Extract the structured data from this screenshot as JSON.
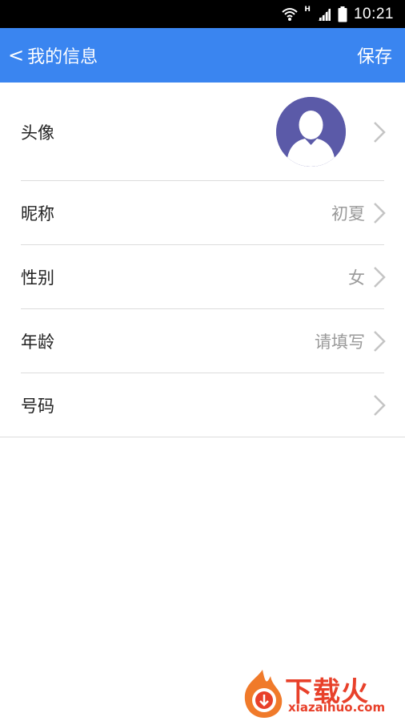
{
  "status_bar": {
    "network_type": "H",
    "time": "10:21",
    "icons": [
      "wifi-icon",
      "signal-icon",
      "battery-icon"
    ]
  },
  "header": {
    "back_label": "我的信息",
    "back_icon": "chevron-left-icon",
    "save_label": "保存",
    "background_color": "#3a85f0"
  },
  "rows": [
    {
      "label": "头像",
      "value": "",
      "icon": "avatar-placeholder"
    },
    {
      "label": "昵称",
      "value": "初夏"
    },
    {
      "label": "性别",
      "value": "女"
    },
    {
      "label": "年龄",
      "value": "请填写"
    },
    {
      "label": "号码",
      "value": ""
    }
  ],
  "watermark": {
    "brand": "下载火",
    "site": "xiazaihuo.com",
    "color": "#e8402a"
  }
}
